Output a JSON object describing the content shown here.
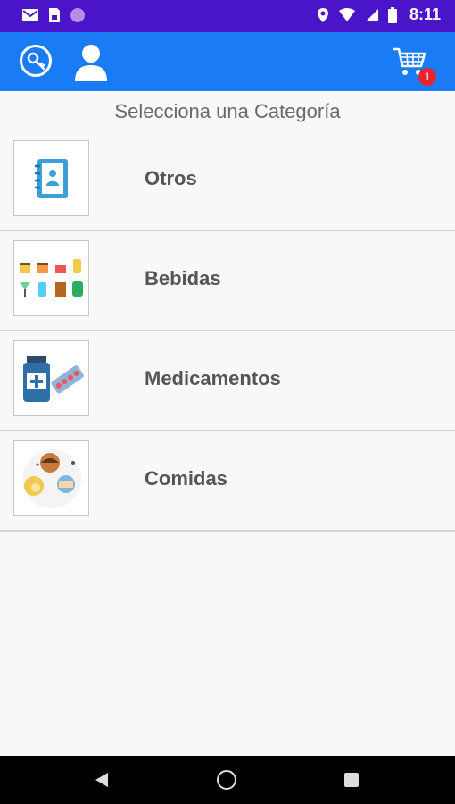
{
  "status_bar": {
    "time": "8:11",
    "icons": [
      "gmail-icon",
      "sim-card-icon",
      "circle-icon",
      "location-icon",
      "wifi-icon",
      "signal-icon",
      "battery-icon"
    ]
  },
  "app_bar": {
    "icons": [
      "key-icon",
      "user-icon",
      "cart-icon"
    ],
    "cart_count": "1",
    "accent_color": "#1a7cf5",
    "badge_color": "#e8232f"
  },
  "main": {
    "title": "Selecciona una Categoría",
    "categories": [
      {
        "label": "Otros",
        "icon": "notebook-icon"
      },
      {
        "label": "Bebidas",
        "icon": "drinks-icon"
      },
      {
        "label": "Medicamentos",
        "icon": "medicine-icon"
      },
      {
        "label": "Comidas",
        "icon": "food-icon"
      }
    ]
  },
  "nav_bar": {
    "icons": [
      "back-icon",
      "home-icon",
      "recents-icon"
    ]
  }
}
